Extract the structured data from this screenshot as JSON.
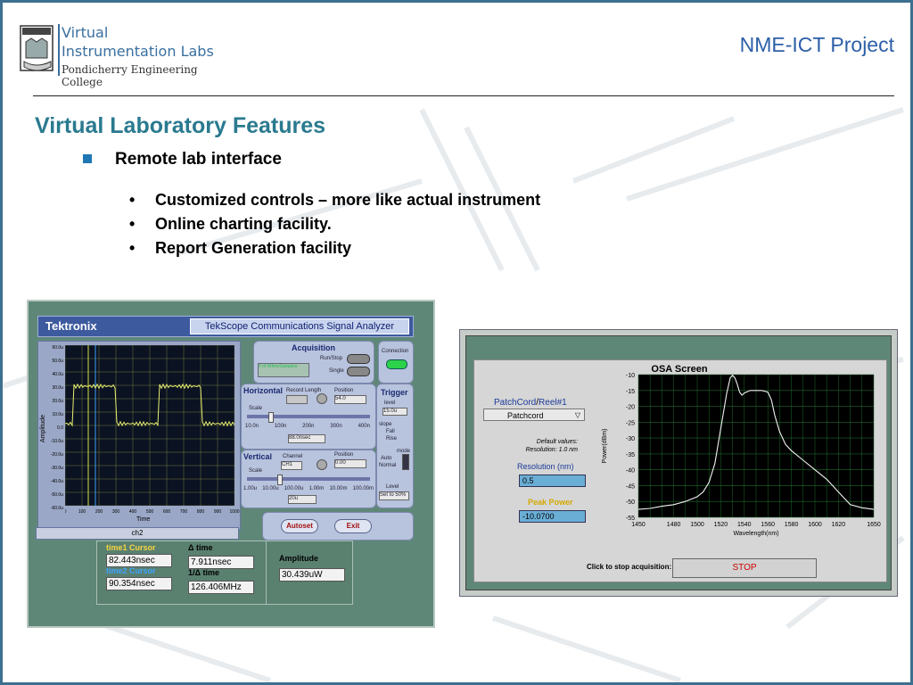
{
  "header": {
    "logo_line1": "Virtual",
    "logo_line2": "Instrumentation Labs",
    "logo_line3": "Pondicherry Engineering College",
    "project": "NME-ICT Project"
  },
  "slide": {
    "title": "Virtual Laboratory Features",
    "bullet": "Remote lab interface",
    "subbullets": [
      "Customized controls – more like actual instrument",
      "Online charting facility.",
      "Report Generation facility"
    ]
  },
  "tek": {
    "logo": "Tektronix",
    "title": "TekScope Communications Signal Analyzer",
    "channel_select": "ch2",
    "x_axis_label": "Time",
    "y_axis_label": "Amplitude",
    "y_ticks": [
      "60.0u",
      "50.0u",
      "40.0u",
      "30.0u",
      "20.0u",
      "10.0u",
      "0.0",
      "-10.0u",
      "-20.0u",
      "-30.0u",
      "-40.0u",
      "-50.0u",
      "-60.0u"
    ],
    "x_ticks": [
      "0",
      "100",
      "200",
      "300",
      "400",
      "500",
      "600",
      "700",
      "800",
      "900",
      "1000"
    ],
    "acquisition": {
      "label": "Acquisition",
      "run_stop": "Run/Stop",
      "single": "Single",
      "samples": "# of Wfms/Samples"
    },
    "connection": "Connection",
    "horizontal": {
      "label": "Horizontal",
      "record_length": "Record Length",
      "position": "Position",
      "position_val": "54.0",
      "scale": "Scale",
      "scale_ticks": [
        "10.0n",
        "100n",
        "200n",
        "300n",
        "400n"
      ],
      "scale_value": "88.0nsec"
    },
    "trigger": {
      "label": "Trigger",
      "level": "level",
      "level_val": "15.0u",
      "slope": "slope",
      "fall": "Fall",
      "rise": "Rise",
      "mode": "mode",
      "auto": "Auto",
      "normal": "Normal",
      "level2": "Level",
      "set50": "Set to 50%"
    },
    "vertical": {
      "label": "Vertical",
      "channel": "Channel",
      "channel_val": "CH1",
      "position": "Position",
      "position_val": "0.00",
      "scale": "Scale",
      "scale_ticks": [
        "1.00u",
        "10.00u",
        "100.00u",
        "1.00m",
        "10.00m",
        "100.00m"
      ],
      "scale_value": "20u"
    },
    "buttons": {
      "autoset": "Autoset",
      "exit": "Exit"
    },
    "cursors": {
      "time1_label": "time1 Cursor",
      "time1_val": "82.443nsec",
      "time2_label": "time2 Cursor",
      "time2_val": "90.354nsec",
      "dtime_label": "Δ time",
      "dtime_val": "7.911nsec",
      "inv_label": "1/Δ time",
      "inv_val": "126.406MHz"
    },
    "amplitude": {
      "label": "Amplitude",
      "value": "30.439uW"
    }
  },
  "osa": {
    "title": "OSA Screen",
    "patch_label_1": "PatchCord",
    "patch_label_sep": "/",
    "patch_label_2": "Reel#1",
    "patch_select": "Patchcord",
    "default_values": "Default values:",
    "default_res": "Resolution: 1.0 nm",
    "resolution_label": "Resolution (nm)",
    "resolution_val": "0.5",
    "peak_label": "Peak Power",
    "peak_val": "-10.0700",
    "stop_label": "Click to stop acquisition:",
    "stop_btn": "STOP"
  },
  "chart_data": {
    "type": "line",
    "title": "OSA Screen",
    "xlabel": "Wavelength(nm)",
    "ylabel": "Power(dBm)",
    "xlim": [
      1450,
      1650
    ],
    "ylim": [
      -55,
      -10
    ],
    "x_ticks": [
      1450,
      1480,
      1500,
      1520,
      1540,
      1560,
      1580,
      1600,
      1620,
      1650
    ],
    "y_ticks": [
      -10,
      -15,
      -20,
      -25,
      -30,
      -35,
      -40,
      -45,
      -50,
      -55
    ],
    "grid": true,
    "series": [
      {
        "x": [
          1450,
          1460,
          1470,
          1480,
          1490,
          1500,
          1505,
          1510,
          1515,
          1520,
          1525,
          1528,
          1530,
          1532,
          1534,
          1536,
          1538,
          1540,
          1545,
          1550,
          1555,
          1560,
          1563,
          1566,
          1570,
          1575,
          1580,
          1590,
          1600,
          1610,
          1620,
          1630,
          1640,
          1650
        ],
        "values": [
          -52.5,
          -52.2,
          -51.5,
          -51,
          -50,
          -48.5,
          -47,
          -44,
          -38,
          -27,
          -16,
          -11,
          -10.2,
          -11,
          -13,
          -15.5,
          -16.5,
          -15.8,
          -15,
          -15,
          -15,
          -15.5,
          -18,
          -23,
          -28,
          -32,
          -34,
          -37,
          -40,
          -43,
          -47,
          -51,
          -52,
          -52.5
        ]
      }
    ]
  }
}
